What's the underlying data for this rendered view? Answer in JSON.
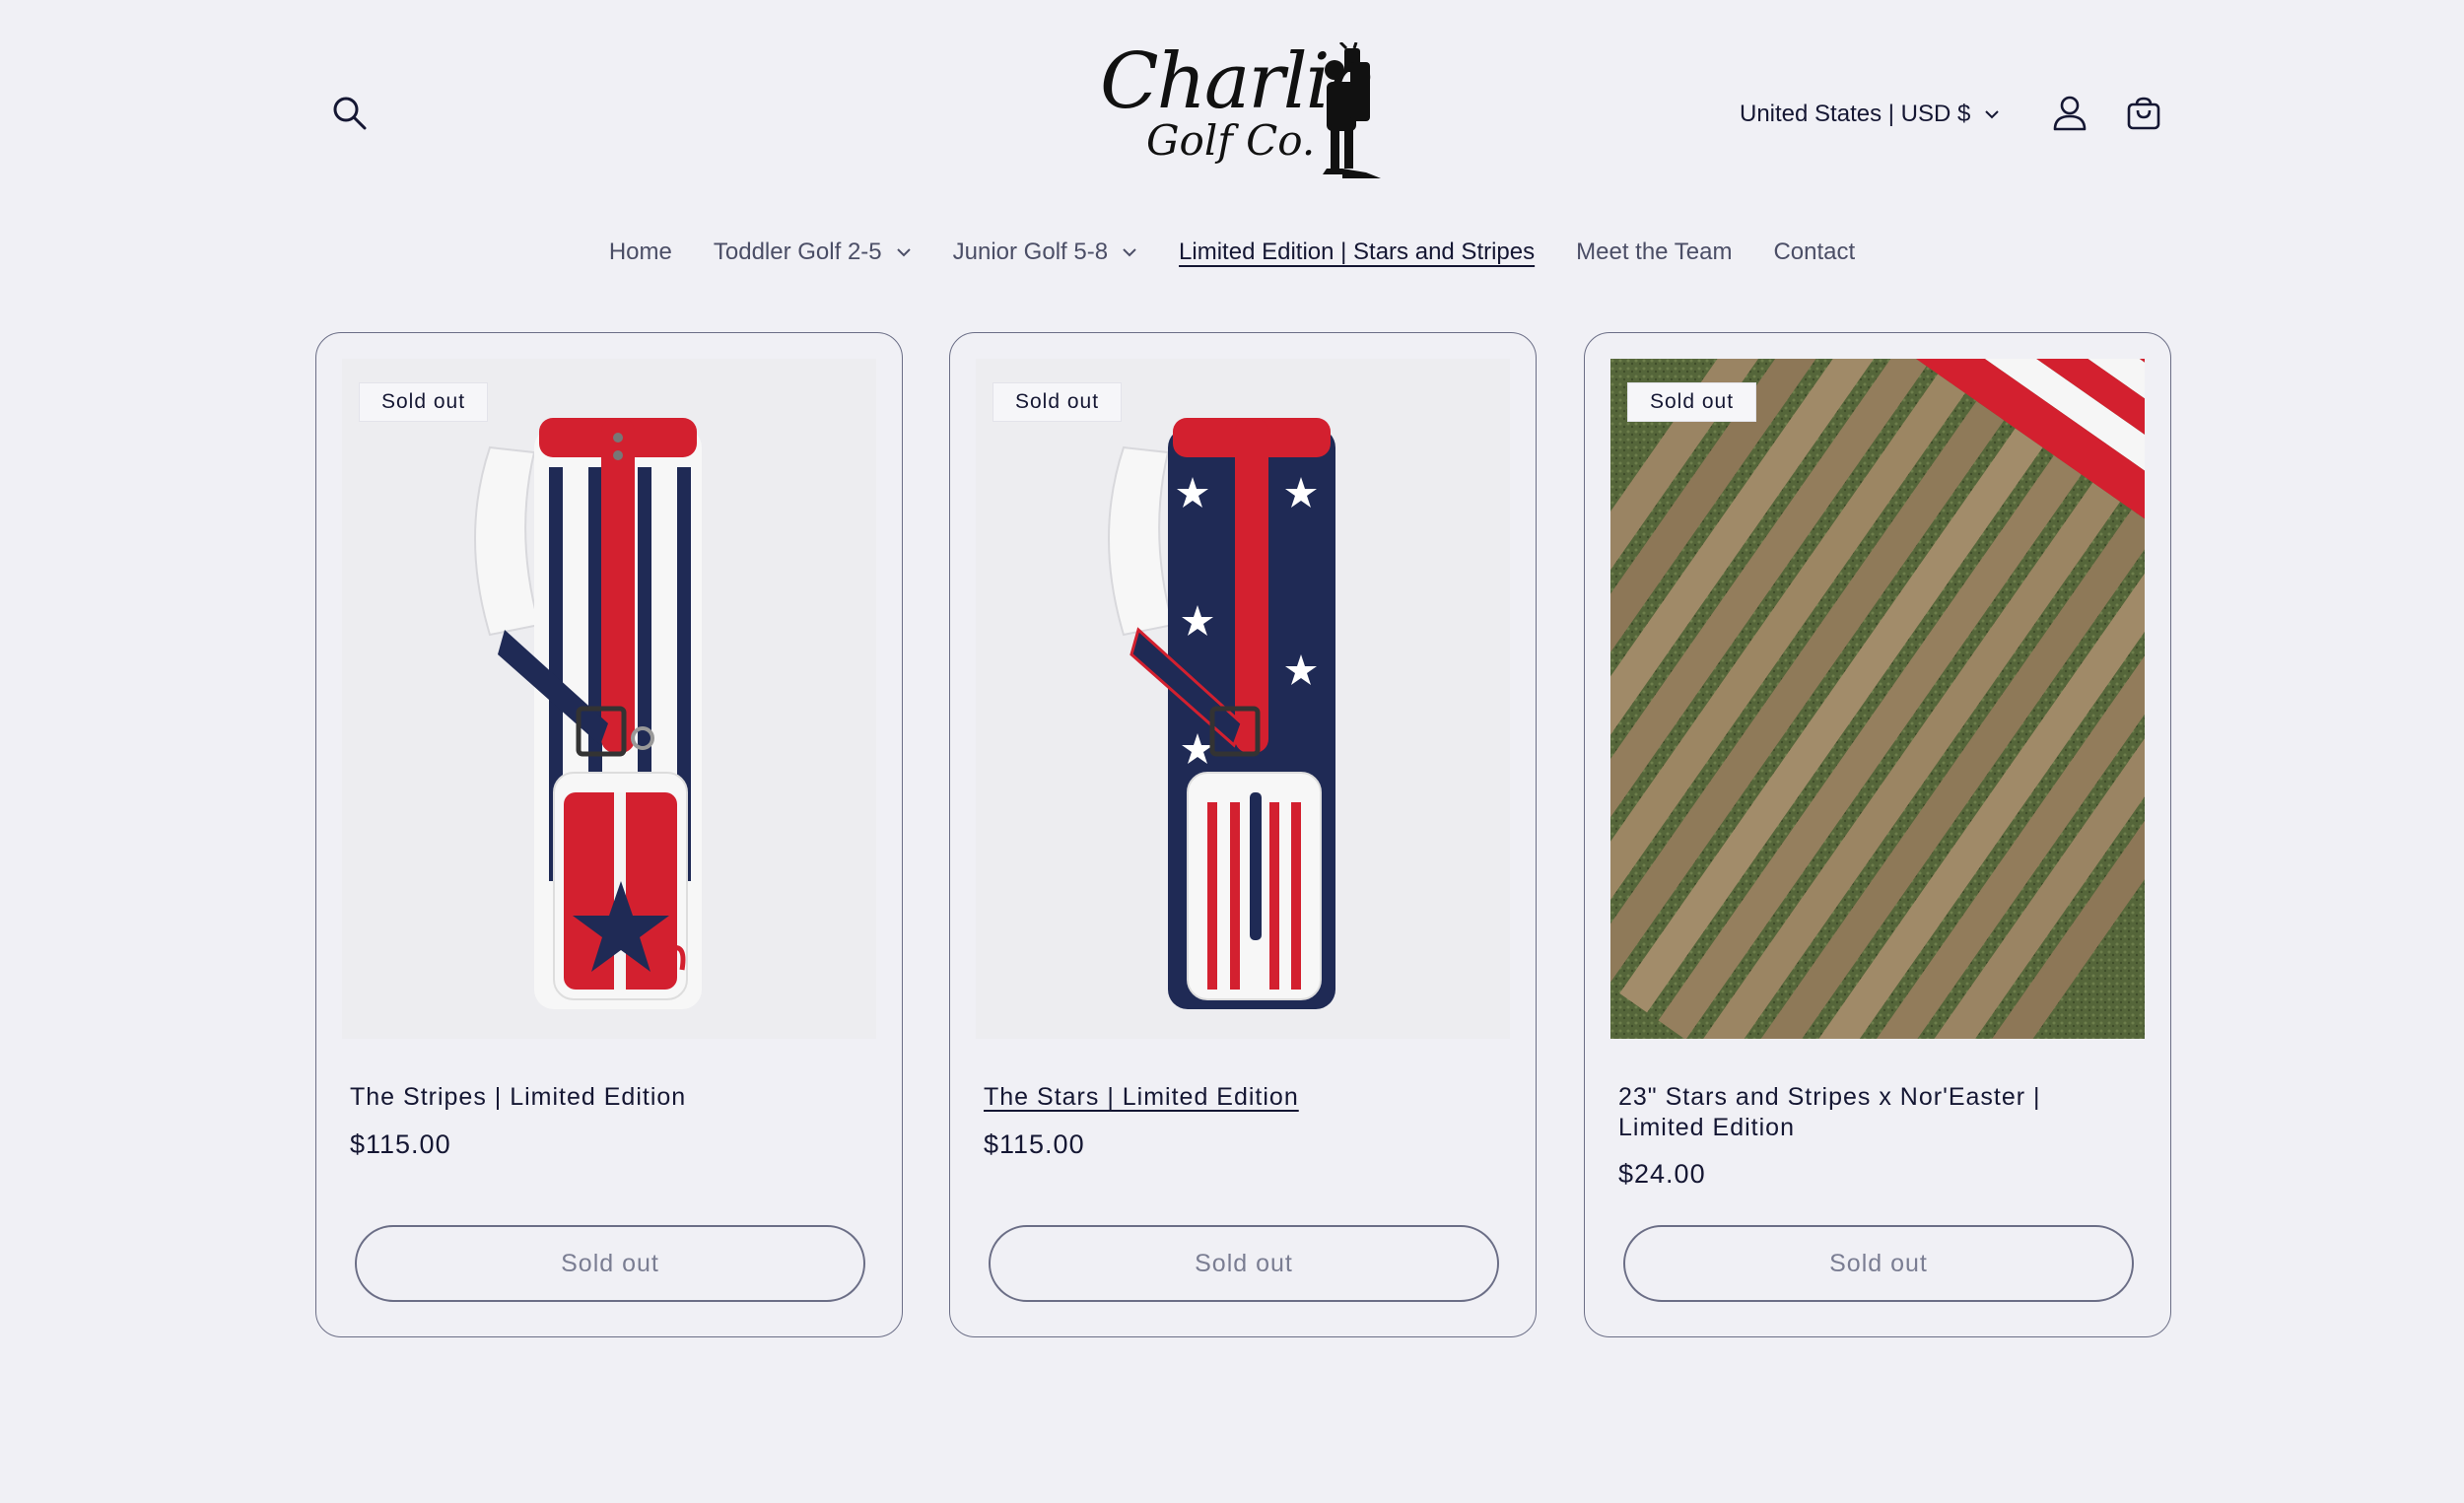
{
  "header": {
    "logo_line1": "Charlie",
    "logo_line2": "Golf Co.",
    "country_label": "United States | USD $"
  },
  "nav": {
    "items": [
      {
        "label": "Home"
      },
      {
        "label": "Toddler Golf 2-5"
      },
      {
        "label": "Junior Golf 5-8"
      },
      {
        "label": "Limited Edition | Stars and Stripes"
      },
      {
        "label": "Meet the Team"
      },
      {
        "label": "Contact"
      }
    ]
  },
  "products": [
    {
      "badge": "Sold out",
      "title": "The Stripes | Limited Edition",
      "price": "$115.00",
      "button": "Sold out"
    },
    {
      "badge": "Sold out",
      "title": "The Stars | Limited Edition",
      "price": "$115.00",
      "button": "Sold out"
    },
    {
      "badge": "Sold out",
      "title": "23\" Stars and Stripes x Nor'Easter | Limited Edition",
      "price": "$24.00",
      "button": "Sold out"
    }
  ],
  "colors": {
    "background": "#f0f0f5",
    "text": "#151733",
    "border": "#6b6e86",
    "red": "#d3202f",
    "navy": "#1f2a55"
  }
}
